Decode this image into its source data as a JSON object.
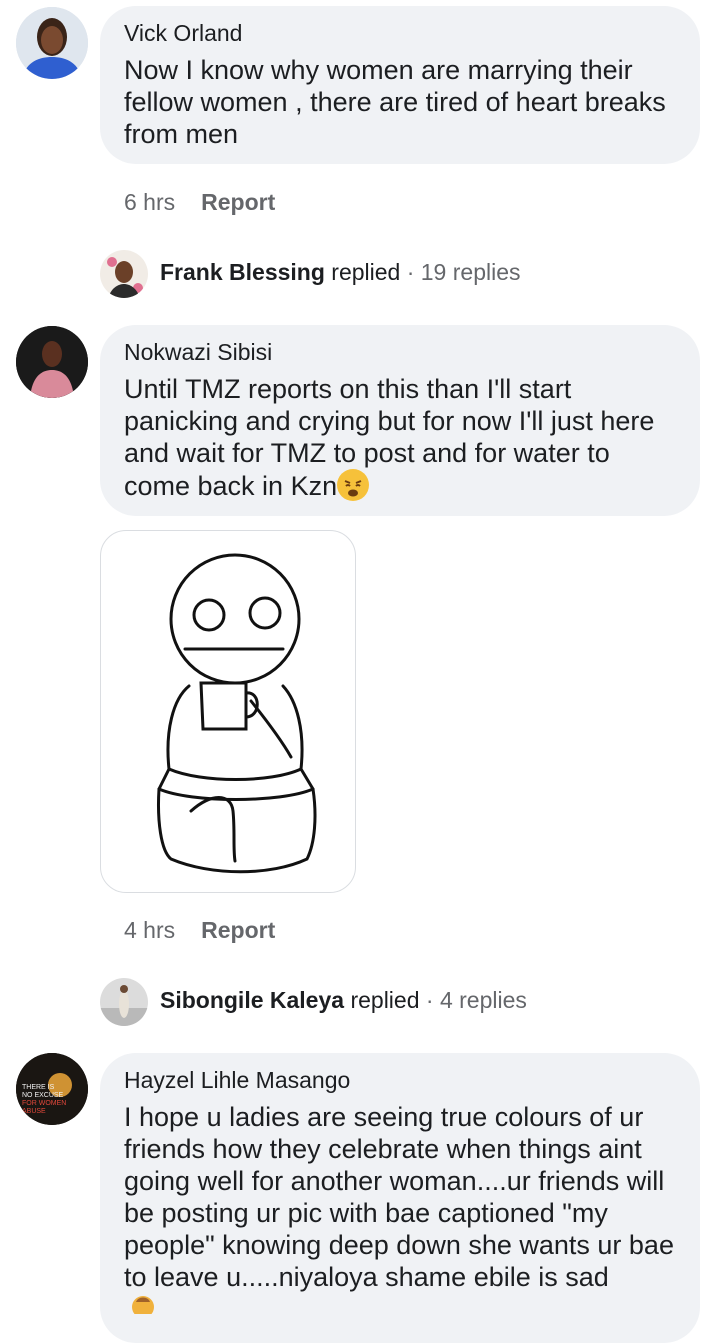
{
  "comments": [
    {
      "author": "Vick Orland",
      "text": "Now I know why women are marrying their fellow women , there are tired of heart breaks from men",
      "time": "6 hrs",
      "report_label": "Report",
      "reply_summary": {
        "name": "Frank Blessing",
        "verb": "replied",
        "count": "· 19 replies"
      }
    },
    {
      "author": "Nokwazi Sibisi",
      "text": "Until TMZ reports on this than I'll start panicking and crying but for now I'll just here and wait for TMZ to post and for water to come back in Kzn",
      "emoji": "weary-face-emoji",
      "time": "4 hrs",
      "report_label": "Report",
      "reply_summary": {
        "name": "Sibongile Kaleya",
        "verb": "replied",
        "count": "· 4 replies"
      }
    },
    {
      "author": "Hayzel Lihle Masango",
      "text": "I hope u ladies are seeing true colours of ur friends how they celebrate when things aint going well for another woman....ur friends will be posting ur pic with bae captioned \"my people\" knowing deep down she wants ur bae to leave u.....niyaloya shame ebile is sad",
      "avatar_text": [
        "THERE IS",
        "NO EXCUSE",
        "FOR WOMEN",
        "ABUSE"
      ]
    }
  ],
  "colors": {
    "bubble": "#f0f2f5",
    "meta": "#65676b",
    "text": "#1c1e21"
  }
}
